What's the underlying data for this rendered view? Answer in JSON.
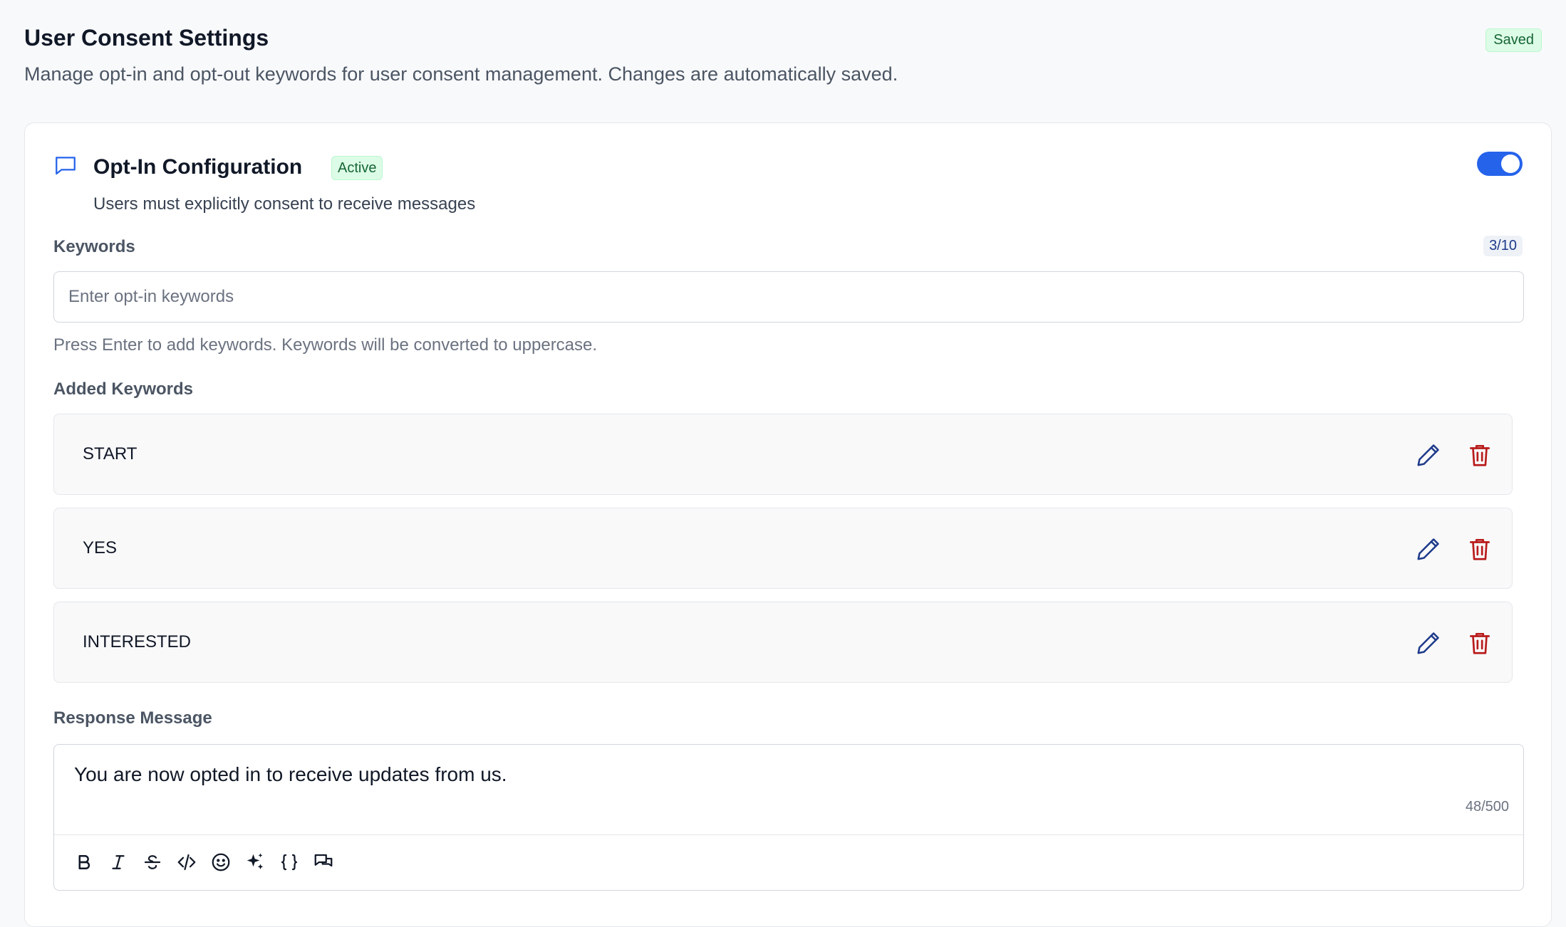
{
  "header": {
    "title": "User Consent Settings",
    "subtitle": "Manage opt-in and opt-out keywords for user consent management. Changes are automatically saved.",
    "saved_badge": "Saved"
  },
  "optin": {
    "icon": "chat-bubble-icon",
    "title": "Opt-In Configuration",
    "status_badge": "Active",
    "description": "Users must explicitly consent to receive messages",
    "enabled": true
  },
  "keywords": {
    "label": "Keywords",
    "count": "3/10",
    "placeholder": "Enter opt-in keywords",
    "value": "",
    "help": "Press Enter to add keywords. Keywords will be converted to uppercase.",
    "added_label": "Added Keywords",
    "items": [
      "START",
      "YES",
      "INTERESTED"
    ],
    "item_icons": [
      "pencil-icon",
      "trash-icon"
    ]
  },
  "response": {
    "label": "Response Message",
    "message": "You are now opted in to receive updates from us.",
    "char_count": "48/500",
    "toolbar_icons": [
      "bold-icon",
      "italic-icon",
      "strikethrough-icon",
      "code-icon",
      "emoji-icon",
      "sparkles-icon",
      "braces-icon",
      "chat-bubbles-icon"
    ]
  },
  "colors": {
    "accent": "#2563eb",
    "edit": "#1e3a8a",
    "delete": "#b91c1c",
    "success_bg": "#dcfce7",
    "success_text": "#166534"
  }
}
